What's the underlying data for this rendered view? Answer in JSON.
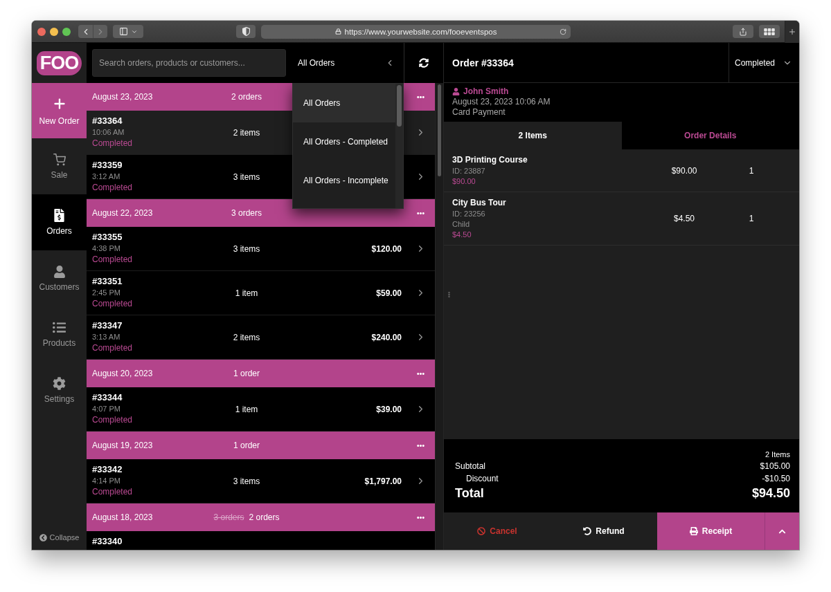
{
  "browser": {
    "url": "https://www.yourwebsite.com/fooeventspos"
  },
  "sidebar": {
    "logo": "FOO",
    "new_order": "New Order",
    "nav": [
      {
        "label": "Sale",
        "selected": false
      },
      {
        "label": "Orders",
        "selected": true
      },
      {
        "label": "Customers",
        "selected": false
      },
      {
        "label": "Products",
        "selected": false
      },
      {
        "label": "Settings",
        "selected": false
      }
    ],
    "collapse": "Collapse"
  },
  "top_bar": {
    "search": {
      "placeholder": "Search orders, products or customers..."
    },
    "filter": {
      "value": "All Orders",
      "expanded": true,
      "options": [
        {
          "label": "All Orders",
          "selected": true
        },
        {
          "label": "All Orders - Completed",
          "selected": false
        },
        {
          "label": "All Orders - Incomplete",
          "selected": false
        }
      ]
    }
  },
  "order_groups": [
    {
      "date": "August 23, 2023",
      "count": "2 orders",
      "orders": [
        {
          "number": "#33364",
          "time": "10:06 AM",
          "status": "Completed",
          "items": "2 items",
          "selected": true
        },
        {
          "number": "#33359",
          "time": "3:12 AM",
          "status": "Completed",
          "items": "3 items",
          "selected": false
        }
      ]
    },
    {
      "date": "August 22, 2023",
      "count": "3 orders",
      "orders": [
        {
          "number": "#33355",
          "time": "4:38 PM",
          "status": "Completed",
          "items": "3 items",
          "total": "$120.00",
          "selected": false
        },
        {
          "number": "#33351",
          "time": "2:45 PM",
          "status": "Completed",
          "items": "1 item",
          "total": "$59.00",
          "selected": false
        },
        {
          "number": "#33347",
          "time": "3:13 AM",
          "status": "Completed",
          "items": "2 items",
          "total": "$240.00",
          "selected": false
        }
      ]
    },
    {
      "date": "August 20, 2023",
      "count": "1 order",
      "orders": [
        {
          "number": "#33344",
          "time": "4:07 PM",
          "status": "Completed",
          "items": "1 item",
          "total": "$39.00",
          "selected": false
        }
      ]
    },
    {
      "date": "August 19, 2023",
      "count": "1 order",
      "orders": [
        {
          "number": "#33342",
          "time": "4:14 PM",
          "status": "Completed",
          "items": "3 items",
          "total": "$1,797.00",
          "selected": false
        }
      ]
    },
    {
      "date": "August 18, 2023",
      "previous_count": "3 orders",
      "count": "2 orders",
      "orders": [
        {
          "number": "#33340",
          "selected": false
        }
      ]
    }
  ],
  "order": {
    "title": "Order #33364",
    "status": "Completed",
    "customer": "John Smith",
    "date": "August 23, 2023 10:06 AM",
    "payment": "Card Payment",
    "tabs": [
      {
        "label": "2 Items",
        "selected": true
      },
      {
        "label": "Order Details",
        "selected": false
      }
    ],
    "line_items": [
      {
        "name": "3D Printing Course",
        "id": "ID: 23887",
        "unit_price": "$90.00",
        "price": "$90.00",
        "quantity": "1"
      },
      {
        "name": "City Bus Tour",
        "id": "ID: 23256",
        "variant": "Child",
        "unit_price": "$4.50",
        "price": "$4.50",
        "quantity": "1"
      }
    ],
    "summary": {
      "item_count": "2 Items",
      "rows": [
        {
          "kind": "subtotal",
          "label": "Subtotal",
          "value": "$105.00"
        },
        {
          "kind": "discount",
          "label": "Discount",
          "value": "-$10.50"
        },
        {
          "kind": "total",
          "label": "Total",
          "value": "$94.50"
        }
      ]
    },
    "actions": [
      {
        "kind": "cancel",
        "label": "Cancel"
      },
      {
        "kind": "refund",
        "label": "Refund"
      },
      {
        "kind": "primary",
        "label": "Receipt"
      }
    ]
  }
}
